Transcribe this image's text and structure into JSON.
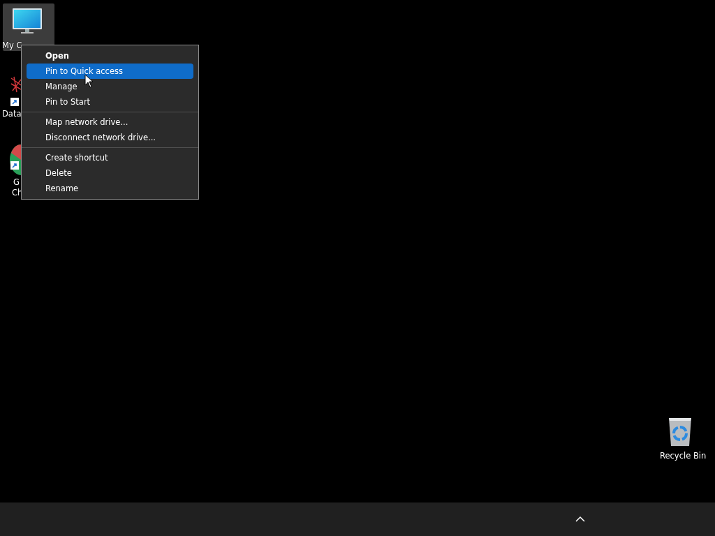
{
  "desktop_icons": [
    {
      "kind": "computer",
      "lines": [
        "My C"
      ],
      "selected": true,
      "shortcut": false
    },
    {
      "kind": "network",
      "lines": [
        "Data"
      ],
      "selected": false,
      "shortcut": true
    },
    {
      "kind": "pie",
      "lines": [
        "G",
        "Ch"
      ],
      "selected": false,
      "shortcut": true
    },
    {
      "kind": "bin",
      "lines": [
        "Recycle Bin"
      ],
      "selected": false,
      "shortcut": false
    }
  ],
  "context_menu": {
    "groups": [
      [
        {
          "label": "Open",
          "default": true,
          "selected": false
        },
        {
          "label": "Pin to Quick access",
          "default": false,
          "selected": true
        },
        {
          "label": "Manage",
          "default": false,
          "selected": false
        },
        {
          "label": "Pin to Start",
          "default": false,
          "selected": false
        }
      ],
      [
        {
          "label": "Map network drive...",
          "default": false,
          "selected": false
        },
        {
          "label": "Disconnect network drive...",
          "default": false,
          "selected": false
        }
      ],
      [
        {
          "label": "Create shortcut",
          "default": false,
          "selected": false
        },
        {
          "label": "Delete",
          "default": false,
          "selected": false
        },
        {
          "label": "Rename",
          "default": false,
          "selected": false
        }
      ]
    ]
  },
  "taskbar": {
    "tray_expander": true
  }
}
